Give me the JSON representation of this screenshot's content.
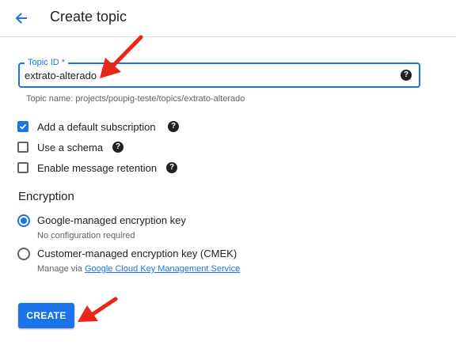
{
  "header": {
    "title": "Create topic",
    "back_icon": "arrow-left-icon"
  },
  "topic_id": {
    "label": "Topic ID *",
    "value": "extrato-alterado",
    "hint": "Topic name: projects/poupig-teste/topics/extrato-alterado",
    "help_icon": "?"
  },
  "options": [
    {
      "label": "Add a default subscription",
      "checked": true
    },
    {
      "label": "Use a schema",
      "checked": false
    },
    {
      "label": "Enable message retention",
      "checked": false
    }
  ],
  "encryption": {
    "title": "Encryption",
    "google_managed": {
      "label": "Google-managed encryption key",
      "sub": "No configuration required",
      "selected": true
    },
    "customer_managed": {
      "label": "Customer-managed encryption key (CMEK)",
      "sub_prefix": "Manage via ",
      "sub_link": "Google Cloud Key Management Service",
      "selected": false
    }
  },
  "actions": {
    "create_label": "CREATE"
  },
  "colors": {
    "accent": "#1a73e8",
    "annotation_arrow": "#e8261a"
  }
}
